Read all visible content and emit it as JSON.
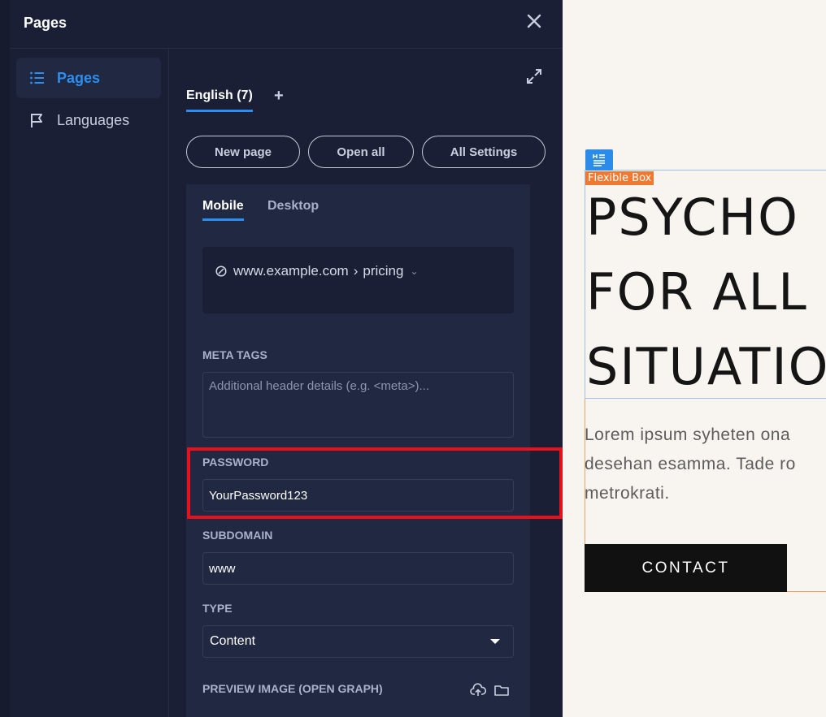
{
  "panel": {
    "title": "Pages",
    "nav": [
      {
        "label": "Pages",
        "icon": "list-icon",
        "active": true
      },
      {
        "label": "Languages",
        "icon": "flag-icon",
        "active": false
      }
    ],
    "language_tab": "English (7)",
    "add_symbol": "+",
    "buttons": {
      "new_page": "New page",
      "open_all": "Open all",
      "all_settings": "All Settings"
    },
    "device_tabs": {
      "mobile": "Mobile",
      "desktop": "Desktop"
    },
    "url": {
      "domain": "www.example.com",
      "separator": "›",
      "page": "pricing"
    },
    "meta_tags": {
      "label": "META TAGS",
      "placeholder": "Additional header details (e.g. <meta>)..."
    },
    "password": {
      "label": "PASSWORD",
      "value": "YourPassword123"
    },
    "subdomain": {
      "label": "SUBDOMAIN",
      "value": "www"
    },
    "type": {
      "label": "TYPE",
      "value": "Content"
    },
    "preview_image": {
      "label": "PREVIEW IMAGE (OPEN GRAPH)"
    }
  },
  "canvas": {
    "flex_label": "Flexible Box",
    "heading_lines": [
      "PSYCHO",
      "FOR ALL",
      "SITUATIO"
    ],
    "body_lines": [
      "Lorem ipsum syheten ona",
      "desehan esamma. Tade ro",
      "metrokrati."
    ],
    "contact_label": "CONTACT"
  },
  "colors": {
    "accent": "#2c8ef0",
    "highlight": "#e8101a",
    "flex_label": "#f07830",
    "panel_bg": "#1a1f35"
  }
}
